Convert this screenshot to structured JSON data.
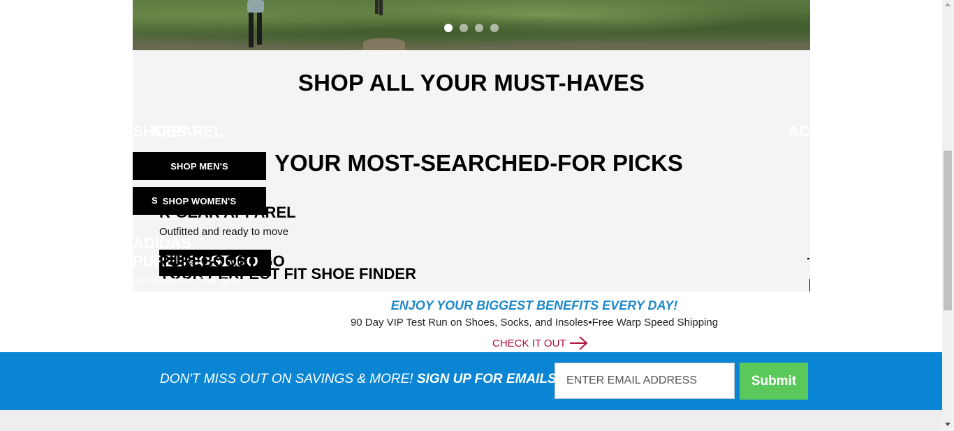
{
  "hero": {
    "slide_count": 4,
    "active_slide": 1
  },
  "section": {
    "heading": "SHOP ALL YOUR MUST-HAVES",
    "ghost_labels": {
      "shoes": "SHOES",
      "apparel": "APPAREL",
      "accessories": "ACC"
    },
    "shop_mens": "SHOP MEN'S",
    "shop_womens": "SHOP WOMEN'S",
    "shop_womens_ghost": "S",
    "picks_heading": "YOUR MOST-SEARCHED-FOR PICKS",
    "gear_heading": "R-GEAR APPAREL",
    "gear_subtitle": "Outfitted and ready to move",
    "shop_now": "SHOP NOW",
    "adidas": "ADIDAS",
    "pureboost": "PUREBOOST GO",
    "designed": "Designed for Changing",
    "finder": "YOUR PERFECT FIT SHOE FINDER"
  },
  "benefits": {
    "title": "ENJOY YOUR BIGGEST BENEFITS EVERY DAY!",
    "subtitle": "90 Day VIP Test Run on Shoes, Socks, and Insoles•Free Warp Speed Shipping",
    "link": "CHECK IT OUT"
  },
  "email_signup": {
    "prompt": "DON'T MISS OUT ON SAVINGS & MORE! ",
    "prompt_bold": "SIGN UP FOR EMAILS",
    "prompt_end": "!",
    "placeholder": "ENTER EMAIL ADDRESS",
    "submit_label": "Submit"
  },
  "colors": {
    "email_bar": "#0a85d4",
    "submit": "#5ac85a",
    "benefit_title": "#1b87c9",
    "link": "#b0103a"
  }
}
